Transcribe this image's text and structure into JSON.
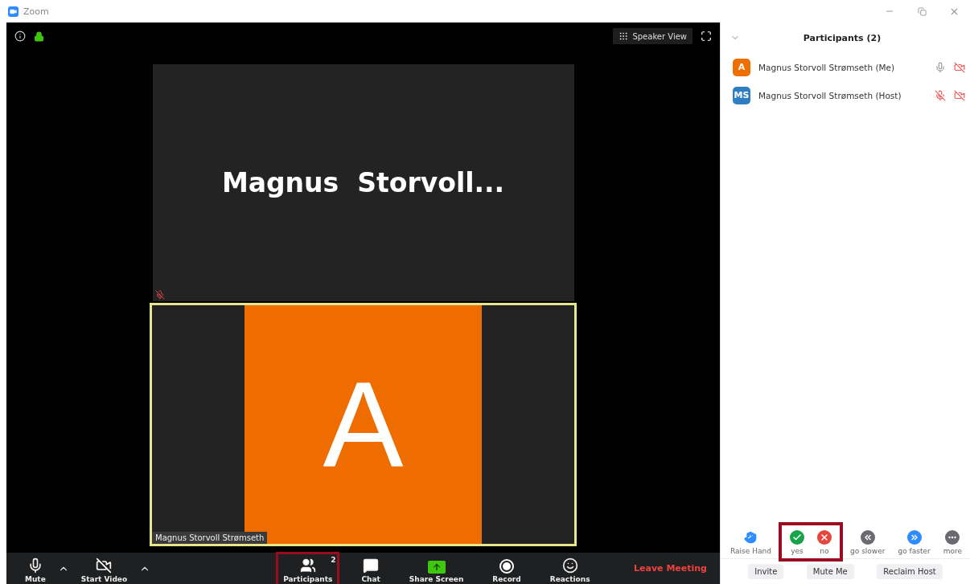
{
  "window": {
    "title": "Zoom"
  },
  "video": {
    "speaker_view": "Speaker View",
    "tiles": [
      {
        "kind": "name",
        "name": "Magnus  Storvoll...",
        "muted": true,
        "active": false
      },
      {
        "kind": "avatar",
        "initial": "A",
        "label": "Magnus Storvoll Strømseth",
        "muted": false,
        "active": true
      }
    ]
  },
  "toolbar": {
    "items": [
      {
        "kind": "mic",
        "label": "Mute",
        "caret": true,
        "highlighted": false
      },
      {
        "kind": "video-off",
        "label": "Start Video",
        "caret": true,
        "highlighted": false
      },
      {
        "kind": "participants",
        "label": "Participants",
        "count": "2",
        "caret": false,
        "highlighted": true
      },
      {
        "kind": "chat",
        "label": "Chat",
        "caret": false,
        "highlighted": false
      },
      {
        "kind": "share",
        "label": "Share Screen",
        "caret": false,
        "highlighted": false
      },
      {
        "kind": "record",
        "label": "Record",
        "caret": false,
        "highlighted": false
      },
      {
        "kind": "reactions",
        "label": "Reactions",
        "caret": false,
        "highlighted": false
      }
    ],
    "leave": "Leave Meeting"
  },
  "panel": {
    "title": "Participants (2)",
    "participants": [
      {
        "initials": "A",
        "color": "#ee6f00",
        "name": "Magnus Storvoll Strømseth (Me)",
        "muted": false,
        "video_off": true
      },
      {
        "initials": "MS",
        "color": "#2d7fc1",
        "name": "Magnus Storvoll Strømseth (Host)",
        "muted": true,
        "video_off": true
      }
    ],
    "feedback": [
      {
        "kind": "hand",
        "label": "Raise Hand",
        "highlighted": false
      },
      {
        "kind": "yes",
        "label": "yes",
        "highlighted": true
      },
      {
        "kind": "no",
        "label": "no",
        "highlighted": true
      },
      {
        "kind": "slower",
        "label": "go slower",
        "highlighted": false
      },
      {
        "kind": "faster",
        "label": "go faster",
        "highlighted": false
      },
      {
        "kind": "more",
        "label": "more",
        "highlighted": false
      }
    ],
    "buttons": [
      "Invite",
      "Mute Me",
      "Reclaim Host"
    ]
  }
}
